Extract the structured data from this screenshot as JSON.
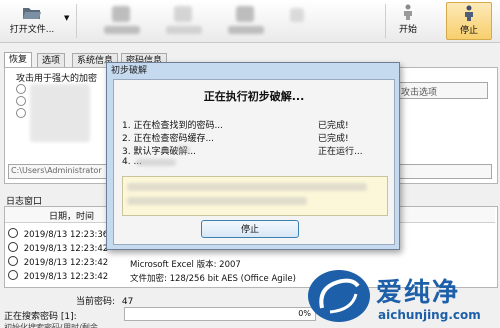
{
  "toolbar": {
    "open_file": "打开文件...",
    "start": "开始",
    "stop": "停止"
  },
  "tabs": [
    "恢复",
    "选项",
    "系统信息",
    "密码信息"
  ],
  "recovery": {
    "attack_label": "攻击用于强大的加密",
    "options_button": "攻击选项",
    "path_value": "C:\\Users\\Administrator"
  },
  "log": {
    "title": "日志窗口",
    "col_datetime": "日期，时间",
    "rows": [
      {
        "time": "2019/8/13 12:23:36",
        "msg": ""
      },
      {
        "time": "2019/8/13 12:23:42",
        "msg": ""
      },
      {
        "time": "2019/8/13 12:23:42",
        "msg": "Microsoft Excel 版本: 2007"
      },
      {
        "time": "2019/8/13 12:23:42",
        "msg": "文件加密: 128/256 bit AES (Office Agile)"
      }
    ]
  },
  "status": {
    "current_password_label": "当前密码:",
    "current_password_value": "47",
    "searching_label": "正在搜索密码 [1]:",
    "progress_text": "0%",
    "progress": 0,
    "bottom_text": "初始化搜索密码(用时/剩余..."
  },
  "dialog": {
    "title": "初步破解",
    "heading": "正在执行初步破解...",
    "steps": [
      {
        "text": "1. 正在检查找到的密码...",
        "status": "已完成!"
      },
      {
        "text": "2. 正在检查密码缓存...",
        "status": "已完成!"
      },
      {
        "text": "3. 默认字典破解...",
        "status": "正在运行..."
      },
      {
        "text": "4. ...",
        "status": ""
      }
    ],
    "stop_button": "停止"
  },
  "watermark": {
    "brand": "爱纯净",
    "url": "aichunjing.com"
  },
  "colors": {
    "dialog_frame": "#c5d9ef",
    "button_border": "#3c7fb1",
    "watermark_blue": "#1d5fa8"
  }
}
